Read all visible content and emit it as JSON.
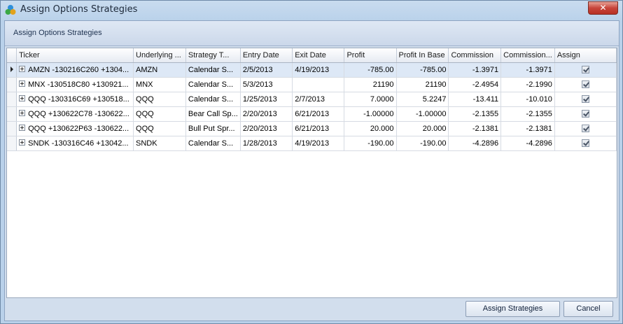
{
  "window": {
    "title": "Assign Options Strategies",
    "close_label": "✕"
  },
  "panel": {
    "caption": "Assign Options Strategies"
  },
  "grid": {
    "columns": [
      "Ticker",
      "Underlying ...",
      "Strategy T...",
      "Entry Date",
      "Exit Date",
      "Profit",
      "Profit In Base",
      "Commission",
      "Commission...",
      "Assign"
    ],
    "rows": [
      {
        "ticker": "AMZN -130216C260 +1304...",
        "underlying": "AMZN",
        "strategy": "Calendar S...",
        "entry": "2/5/2013",
        "exit": "4/19/2013",
        "profit": "-785.00",
        "profit_base": "-785.00",
        "commission": "-1.3971",
        "commission_base": "-1.3971",
        "assign": true
      },
      {
        "ticker": "MNX -130518C80 +130921...",
        "underlying": "MNX",
        "strategy": "Calendar S...",
        "entry": "5/3/2013",
        "exit": "",
        "profit": "21190",
        "profit_base": "21190",
        "commission": "-2.4954",
        "commission_base": "-2.1990",
        "assign": true
      },
      {
        "ticker": "QQQ -130316C69 +130518...",
        "underlying": "QQQ",
        "strategy": "Calendar S...",
        "entry": "1/25/2013",
        "exit": "2/7/2013",
        "profit": "7.0000",
        "profit_base": "5.2247",
        "commission": "-13.411",
        "commission_base": "-10.010",
        "assign": true
      },
      {
        "ticker": "QQQ +130622C78 -130622...",
        "underlying": "QQQ",
        "strategy": "Bear Call Sp...",
        "entry": "2/20/2013",
        "exit": "6/21/2013",
        "profit": "-1.00000",
        "profit_base": "-1.00000",
        "commission": "-2.1355",
        "commission_base": "-2.1355",
        "assign": true
      },
      {
        "ticker": "QQQ +130622P63 -130622...",
        "underlying": "QQQ",
        "strategy": "Bull Put Spr...",
        "entry": "2/20/2013",
        "exit": "6/21/2013",
        "profit": "20.000",
        "profit_base": "20.000",
        "commission": "-2.1381",
        "commission_base": "-2.1381",
        "assign": true
      },
      {
        "ticker": "SNDK -130316C46 +13042...",
        "underlying": "SNDK",
        "strategy": "Calendar S...",
        "entry": "1/28/2013",
        "exit": "4/19/2013",
        "profit": "-190.00",
        "profit_base": "-190.00",
        "commission": "-4.2896",
        "commission_base": "-4.2896",
        "assign": true
      }
    ]
  },
  "footer": {
    "assign_label": "Assign Strategies",
    "cancel_label": "Cancel"
  }
}
